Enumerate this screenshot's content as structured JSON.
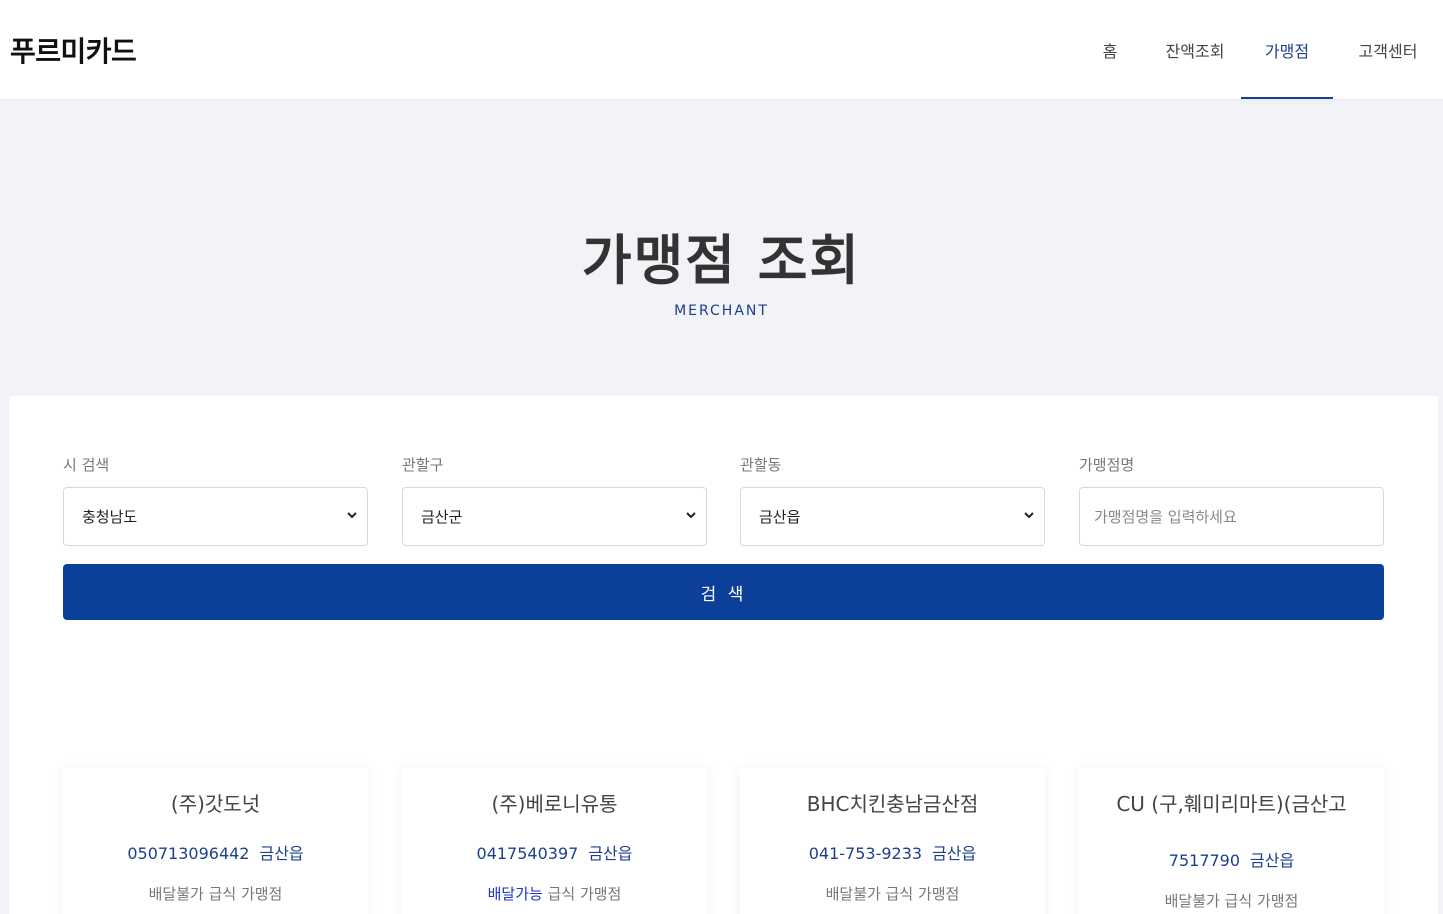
{
  "header": {
    "logo": "푸르미카드",
    "nav": [
      {
        "label": "홈"
      },
      {
        "label": "잔액조회"
      },
      {
        "label": "가맹점",
        "active": true
      },
      {
        "label": "고객센터"
      }
    ]
  },
  "hero": {
    "title": "가맹점 조회",
    "subtitle": "MERCHANT"
  },
  "search": {
    "city_label": "시 검색",
    "city_value": "충청남도",
    "district_label": "관할구",
    "district_value": "금산군",
    "dong_label": "관할동",
    "dong_value": "금산읍",
    "name_label": "가맹점명",
    "name_placeholder": "가맹점명을 입력하세요",
    "button_label": "검 색"
  },
  "results": [
    {
      "name": "(주)갓도넛",
      "phone": "050713096442",
      "area": "금산읍",
      "delivery": "배달불가",
      "type": "급식 가맹점"
    },
    {
      "name": "(주)베로니유통",
      "phone": "0417540397",
      "area": "금산읍",
      "delivery": "배달가능",
      "type": "급식 가맹점"
    },
    {
      "name": "BHC치킨충남금산점",
      "phone": "041-753-9233",
      "area": "금산읍",
      "delivery": "배달불가",
      "type": "급식 가맹점"
    },
    {
      "name": "CU (구,훼미리마트)(금산고",
      "phone": "7517790",
      "area": "금산읍",
      "delivery": "배달불가",
      "type": "급식 가맹점"
    }
  ],
  "colors": {
    "accent": "#1c3f8c",
    "button": "#0b3f99",
    "delivery_available": "#1c37c9"
  },
  "icons": {
    "select_arrow": "chevron-down-icon"
  }
}
